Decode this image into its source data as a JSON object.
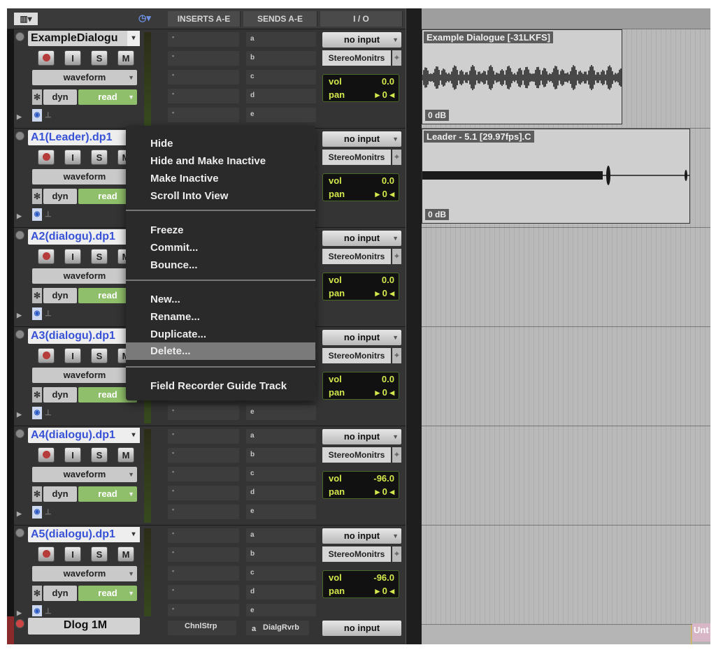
{
  "header": {
    "insert_label": "INSERTS A-E",
    "send_label": "SENDS A-E",
    "io_label": "I / O"
  },
  "tracks": [
    {
      "name": "ExampleDialogu",
      "name_style": "plain",
      "view": "waveform",
      "dyn": "dyn",
      "mode": "read",
      "input": "no input",
      "output": "StereoMonitrs",
      "vol_label": "vol",
      "vol": "0.0",
      "pan_label": "pan",
      "pan": "0",
      "sends": [
        "a",
        "b",
        "c",
        "d",
        "e"
      ]
    },
    {
      "name": "A1(Leader).dp1",
      "view": "waveform",
      "dyn": "dyn",
      "mode": "read",
      "input": "no input",
      "output": "StereoMonitrs",
      "vol_label": "vol",
      "vol": "0.0",
      "pan_label": "pan",
      "pan": "0"
    },
    {
      "name": "A2(dialogu).dp1",
      "view": "waveform",
      "dyn": "dyn",
      "mode": "read",
      "input": "no input",
      "output": "StereoMonitrs",
      "vol_label": "vol",
      "vol": "0.0",
      "pan_label": "pan",
      "pan": "0"
    },
    {
      "name": "A3(dialogu).dp1",
      "view": "waveform",
      "dyn": "dyn",
      "mode": "read",
      "input": "no input",
      "output": "StereoMonitrs",
      "vol_label": "vol",
      "vol": "0.0",
      "pan_label": "pan",
      "pan": "0",
      "sends": [
        "e"
      ]
    },
    {
      "name": "A4(dialogu).dp1",
      "view": "waveform",
      "dyn": "dyn",
      "mode": "read",
      "input": "no input",
      "output": "StereoMonitrs",
      "vol_label": "vol",
      "vol": "-96.0",
      "pan_label": "pan",
      "pan": "0",
      "sends": [
        "a",
        "b",
        "c",
        "d",
        "e"
      ]
    },
    {
      "name": "A5(dialogu).dp1",
      "view": "waveform",
      "dyn": "dyn",
      "mode": "read",
      "input": "no input",
      "output": "StereoMonitrs",
      "vol_label": "vol",
      "vol": "-96.0",
      "pan_label": "pan",
      "pan": "0",
      "sends": [
        "a",
        "b",
        "c",
        "d",
        "e"
      ]
    },
    {
      "name": "Dlog 1M",
      "input": "no input",
      "insert": "ChnlStrp",
      "send_letter": "a",
      "send": "DialgRvrb"
    }
  ],
  "buttons": {
    "input": "I",
    "solo": "S",
    "mute": "M"
  },
  "clips": [
    {
      "title": "Example Dialogue [-31LKFS]",
      "gain": "0 dB"
    },
    {
      "title": "Leader - 5.1 [29.97fps].C",
      "gain": "0 dB"
    }
  ],
  "context_menu": {
    "items": [
      "Hide",
      "Hide and Make Inactive",
      "Make Inactive",
      "Scroll Into View",
      "Freeze",
      "Commit...",
      "Bounce...",
      "New...",
      "Rename...",
      "Duplicate...",
      "Delete...",
      "Field Recorder Guide Track"
    ],
    "highlighted": "Delete..."
  },
  "edge_clip": "Unt",
  "colors": {
    "track_name": "#3752d6",
    "read": "#8fbf6a",
    "meter_text": "#d4e84b",
    "playhead": "#e6b033"
  }
}
